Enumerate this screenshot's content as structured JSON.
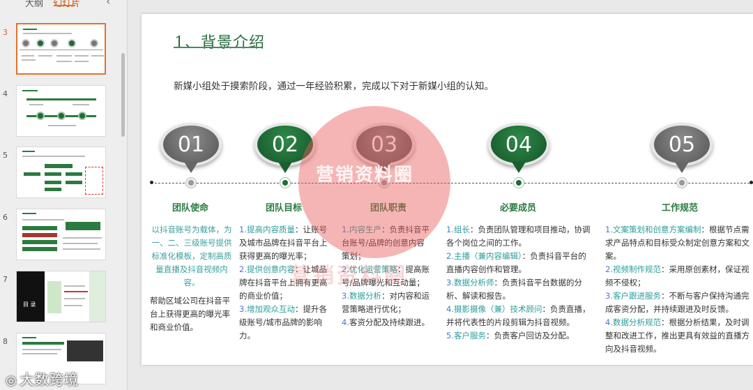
{
  "panel": {
    "tabs": {
      "outline": "大纲",
      "slides": "幻灯片"
    },
    "slides": [
      {
        "number": "3",
        "active": true
      },
      {
        "number": "4",
        "active": false
      },
      {
        "number": "5",
        "active": false
      },
      {
        "number": "6",
        "active": false
      },
      {
        "number": "7",
        "active": false,
        "label": "目 录"
      },
      {
        "number": "8",
        "active": false
      }
    ]
  },
  "watermark_bottom": "大数跨境",
  "slide": {
    "title": "1、背景介绍",
    "intro": "新媒小组处于摸索阶段，通过一年经验积累，完成以下对于新媒小组的认知。",
    "pins": [
      {
        "label": "01",
        "color": "gray"
      },
      {
        "label": "02",
        "color": "green"
      },
      {
        "label": "03",
        "color": "gray"
      },
      {
        "label": "04",
        "color": "green"
      },
      {
        "label": "05",
        "color": "gray"
      }
    ],
    "columns": [
      {
        "title": "团队使命",
        "text_a": "以抖音账号为载体，为一、二、三级账号提供标准化模板，定制高质量直播及抖音视频内容。",
        "text_b": "帮助区域公司在抖音平台上获得更高的曝光率和商业价值。"
      },
      {
        "title": "团队目标",
        "items": [
          {
            "n": "1.",
            "k": "提高内容质量",
            "t": "：让账号及城市品牌在抖音平台上获得更高的曝光率；"
          },
          {
            "n": "2.",
            "k": "提供创意内容",
            "t": "：让城品牌在抖音平台上拥有更高的商业价值；"
          },
          {
            "n": "3.",
            "k": "增加观众互动",
            "t": "：提升各级账号/城市品牌的影响力。"
          }
        ]
      },
      {
        "title": "团队职责",
        "items": [
          {
            "n": "1.",
            "k": "内容生产",
            "t": "：负责抖音平台账号/品牌的创意内容策划；"
          },
          {
            "n": "2.",
            "k": "优化运营策略",
            "t": "：提高账号/品牌曝光和互动量；"
          },
          {
            "n": "3.",
            "k": "数据分析",
            "t": "：对内容和运营策略进行优化；"
          },
          {
            "n": "4.",
            "k": "",
            "t": "客资分配及持续跟进。"
          }
        ]
      },
      {
        "title": "必要成员",
        "items": [
          {
            "n": "1.",
            "k": "组长",
            "t": "：负责团队管理和项目推动，协调各个岗位之间的工作。"
          },
          {
            "n": "2.",
            "k": "主播（兼内容编辑）",
            "t": "：负责抖音平台的直播内容创作和管理。"
          },
          {
            "n": "3.",
            "k": "数据分析师",
            "t": "：负责抖音平台数据的分析、解读和报告。"
          },
          {
            "n": "4.",
            "k": "摄影摄像（兼）技术顾问",
            "t": "：负责直播，并将代表性的片段剪辑为抖音视频。"
          },
          {
            "n": "5.",
            "k": "客户服务",
            "t": "：负责客户回访及分配。"
          }
        ]
      },
      {
        "title": "工作规范",
        "items": [
          {
            "n": "1.",
            "k": "文案策划和创意方案编制",
            "t": "：根据节点需求产品特点和目标受众制定创意方案和文案。"
          },
          {
            "n": "2.",
            "k": "视频制作规范",
            "t": "：采用原创素材，保证视频不侵权；"
          },
          {
            "n": "3.",
            "k": "客户跟进服务",
            "t": "：不断与客户保持沟通完成客资分配，并持续跟进及时反馈。"
          },
          {
            "n": "4.",
            "k": "数据分析规范",
            "t": "：根据分析结果，及时调整和改进工作，推出更具有效益的直播方向及抖音视频。"
          }
        ]
      }
    ],
    "overlay_watermark": "营销资料圈",
    "overlay_watermark_2": "营销资料圈"
  }
}
